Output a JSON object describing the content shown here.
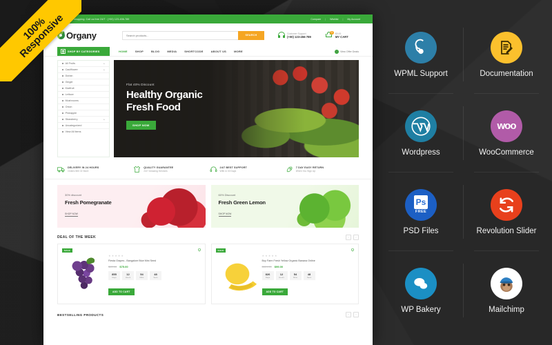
{
  "ribbon": {
    "line1": "100%",
    "line2": "Responsive"
  },
  "site": {
    "topbar": {
      "message": "Good luck with shopping. Call us free 24/7 : (+00) 123-456-789",
      "links": [
        "Compare",
        "Wishlist",
        "My Account"
      ]
    },
    "header": {
      "logo_text": "Organy",
      "search_placeholder": "Search products...",
      "search_value": "",
      "search_button": "SEARCH",
      "support_label": "Customer Support",
      "support_phone": "(+00) 123-456-789",
      "cart_count": "0",
      "cart_price": "$0.00",
      "cart_label": "MY CART"
    },
    "nav": {
      "categories_button": "SHOP BY CATEGORIES",
      "menu": [
        "HOME",
        "SHOP",
        "BLOG",
        "MEDIA",
        "SHORTCODE",
        "ABOUT US",
        "MORE"
      ],
      "offer_text": "View Offer Deals",
      "offer_icon": "tag-icon"
    },
    "sidebar": {
      "items": [
        {
          "label": "All Fruits",
          "has_arrow": true
        },
        {
          "label": "Cauliflower",
          "has_arrow": true
        },
        {
          "label": "Durian",
          "has_arrow": false
        },
        {
          "label": "Ginger",
          "has_arrow": false
        },
        {
          "label": "Kiwifruit",
          "has_arrow": false
        },
        {
          "label": "Lettuce",
          "has_arrow": false
        },
        {
          "label": "Mushrooms",
          "has_arrow": false
        },
        {
          "label": "Onion",
          "has_arrow": false
        },
        {
          "label": "Pineapple",
          "has_arrow": false
        },
        {
          "label": "Strawberry",
          "has_arrow": true
        },
        {
          "label": "Uncategorized",
          "has_arrow": false
        },
        {
          "label": "View All Items",
          "has_arrow": false
        }
      ]
    },
    "hero": {
      "kicker": "Flat 40% Discount",
      "title_line1": "Healthy Organic",
      "title_line2": "Fresh Food",
      "button": "SHOP NOW"
    },
    "features": [
      {
        "icon": "truck-icon",
        "title": "DELIVERY IN 24 HOURS",
        "sub": "Orders $50 Or More"
      },
      {
        "icon": "shirt-icon",
        "title": "QUALITY GUARANTEE",
        "sub": "24/7 Amazing Services"
      },
      {
        "icon": "headset-icon",
        "title": "24/7 BEST SUPPORT",
        "sub": "With in 30 Days"
      },
      {
        "icon": "rocket-icon",
        "title": "7 DAY EASY RETURN",
        "sub": "When You Sign Up"
      }
    ],
    "promos": [
      {
        "kicker": "30% discount",
        "title": "Fresh Pomegranate",
        "button": "SHOP NOW"
      },
      {
        "kicker": "60% Discount",
        "title": "Fresh Green Lemon",
        "button": "SHOP NOW"
      }
    ],
    "deal_section": {
      "title": "DEAL OF THE WEEK",
      "prev": "‹",
      "next": "›",
      "products": [
        {
          "badge": "SALE",
          "name": "Fiesta Grapes - Bangalore Blue Mini Seed",
          "price_old": "$40.00",
          "price_new": "$75.00",
          "stars": 5,
          "stars_filled": 0,
          "countdown": [
            {
              "value": "855",
              "unit": "Days"
            },
            {
              "value": "12",
              "unit": "Hours"
            },
            {
              "value": "54",
              "unit": "Mins"
            },
            {
              "value": "48",
              "unit": "Secs"
            }
          ],
          "button": "ADD TO CART"
        },
        {
          "badge": "SALE",
          "name": "Buy Farm Fresh Yellow Organic Banana Online",
          "price_old": "$119.00",
          "price_new": "$99.00",
          "stars": 5,
          "stars_filled": 0,
          "countdown": [
            {
              "value": "826",
              "unit": "Days"
            },
            {
              "value": "12",
              "unit": "Hours"
            },
            {
              "value": "54",
              "unit": "Mins"
            },
            {
              "value": "48",
              "unit": "Secs"
            }
          ],
          "button": "ADD TO CART"
        }
      ]
    },
    "bottom_section": {
      "title": "BESTSELLING PRODUCTS",
      "prev": "‹",
      "next": "›"
    }
  },
  "feature_grid": [
    {
      "label": "WPML Support",
      "icon": "wpml-icon",
      "color": "#2d7fa8"
    },
    {
      "label": "Documentation",
      "icon": "document-icon",
      "color": "#fbc02d"
    },
    {
      "label": "Wordpress",
      "icon": "wordpress-icon",
      "color": "#1f7fa3"
    },
    {
      "label": "WooCommerce",
      "icon": "woocommerce-icon",
      "color": "#b15ba8"
    },
    {
      "label": "PSD Files",
      "icon": "psd-icon",
      "color": "#1c5fc4"
    },
    {
      "label": "Revolution Slider",
      "icon": "refresh-icon",
      "color": "#e8401c"
    },
    {
      "label": "WP Bakery",
      "icon": "bakery-icon",
      "color": "#1b8fc4"
    },
    {
      "label": "Mailchimp",
      "icon": "mailchimp-icon",
      "color": "#ffffff"
    }
  ]
}
